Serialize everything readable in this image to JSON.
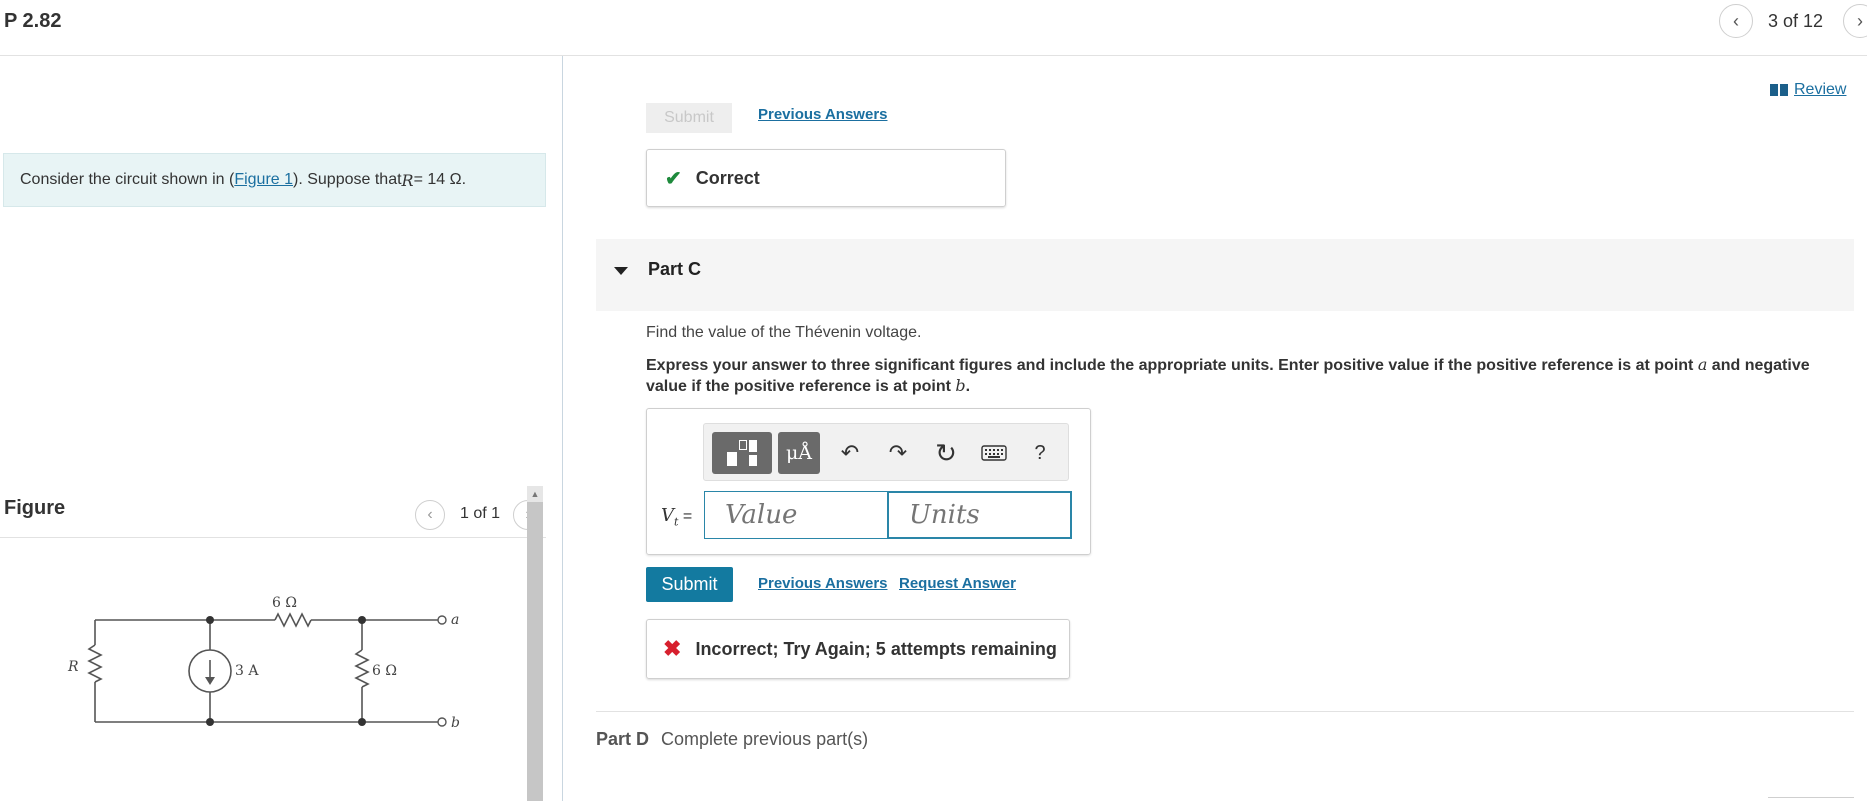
{
  "header": {
    "problem_title": "P 2.82",
    "page_count": "3 of 12",
    "prev_icon": "chevron-left-icon",
    "next_icon": "chevron-right-icon"
  },
  "intro": {
    "prefix": "Consider the circuit shown in (",
    "figure_link": "Figure 1",
    "mid": "). Suppose that ",
    "var": "R",
    "value": " = 14 Ω."
  },
  "figure": {
    "title": "Figure",
    "count": "1 of 1",
    "labels": {
      "r_left": "R",
      "source": "3 A",
      "r_top": "6 Ω",
      "r_right": "6 Ω",
      "node_a": "a",
      "node_b": "b"
    }
  },
  "review": {
    "label": "Review",
    "icon": "book-icon"
  },
  "part_b": {
    "submit_label": "Submit",
    "previous_answers": "Previous Answers",
    "feedback": "Correct"
  },
  "part_c": {
    "label": "Part C",
    "question": "Find the value of the Thévenin voltage.",
    "instructions_1": "Express your answer to three significant figures and include the appropriate units. Enter positive value if the positive reference is at point ",
    "point_a": "a",
    "instructions_2": " and negative value if the positive reference is at point ",
    "point_b": "b",
    "instructions_3": ".",
    "toolbar": {
      "units_label": "μÅ",
      "help_label": "?"
    },
    "var_main": "V",
    "var_sub": "t",
    "var_eq": " =",
    "value_placeholder": "Value",
    "units_placeholder": "Units",
    "submit_label": "Submit",
    "previous_answers": "Previous Answers",
    "request_answer": "Request Answer",
    "feedback": "Incorrect; Try Again; 5 attempts remaining"
  },
  "part_d": {
    "label": "Part D",
    "status": "Complete previous part(s)"
  }
}
